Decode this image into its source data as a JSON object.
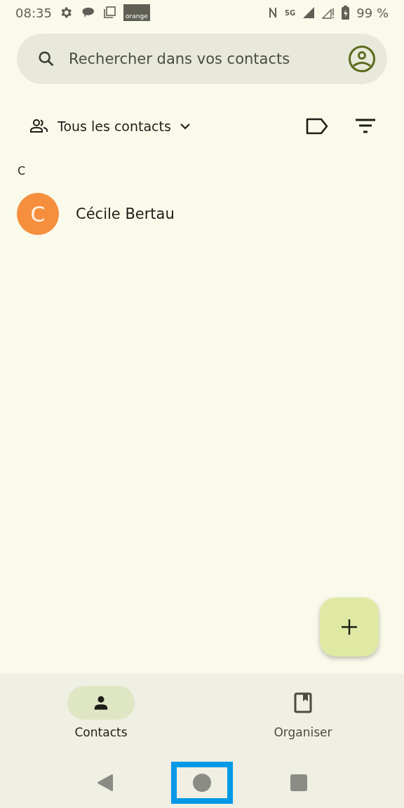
{
  "status_bar": {
    "time": "08:35",
    "carrier_logo": "orange",
    "network": "5G",
    "battery": "99 %"
  },
  "search": {
    "placeholder": "Rechercher dans vos contacts"
  },
  "filter": {
    "label": "Tous les contacts"
  },
  "sections": [
    {
      "letter": "C",
      "contacts": [
        {
          "name": "Cécile Bertau",
          "initial": "C",
          "color": "#f58f3d"
        }
      ]
    }
  ],
  "bottom_nav": [
    {
      "label": "Contacts",
      "selected": true,
      "kind": "person"
    },
    {
      "label": "Organiser",
      "selected": false,
      "kind": "book"
    }
  ],
  "system_nav": [
    {
      "kind": "back",
      "highlighted": false
    },
    {
      "kind": "home",
      "highlighted": true
    },
    {
      "kind": "recents",
      "highlighted": false
    }
  ]
}
